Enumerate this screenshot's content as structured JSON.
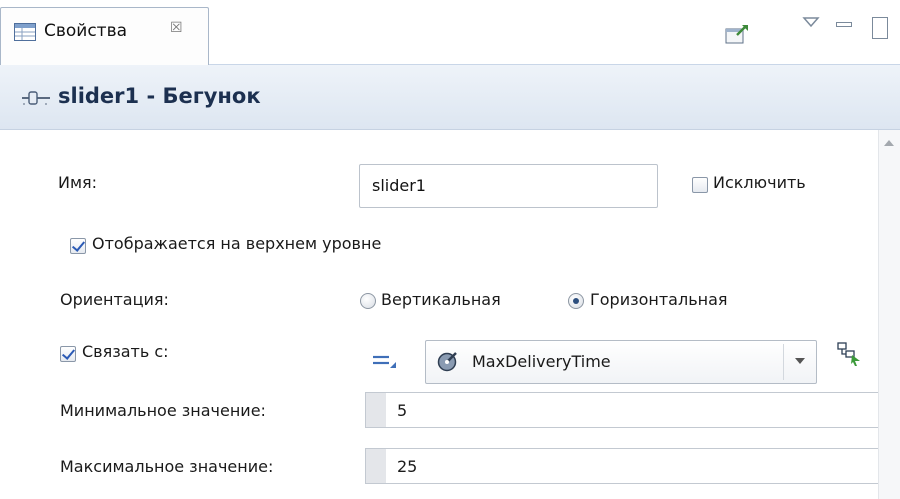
{
  "tab": {
    "label": "Свойства",
    "close_glyph": "☒",
    "icons": {
      "view": "properties-view-icon",
      "close": "close-icon",
      "pin": "pin-editor-icon",
      "menu": "view-menu-icon",
      "minimize": "minimize-icon",
      "maximize": "maximize-icon"
    }
  },
  "title": {
    "text": "slider1 - Бегунок",
    "icon": "slider-icon"
  },
  "form": {
    "name_label": "Имя:",
    "name_value": "slider1",
    "exclude_label": "Исключить",
    "exclude_checked": false,
    "top_level_label": "Отображается на верхнем уровне",
    "top_level_checked": true,
    "orientation_label": "Ориентация:",
    "orientation_options": [
      "Вертикальная",
      "Горизонтальная"
    ],
    "orientation_selected": "Горизонтальная",
    "link_label": "Связать с:",
    "link_checked": true,
    "link_value": "MaxDeliveryTime",
    "min_label": "Минимальное значение:",
    "min_value": "5",
    "max_label": "Максимальное значение:",
    "max_value": "25"
  },
  "colors": {
    "title_text": "#1c3050",
    "title_bg": "#dde6f1",
    "checkbox_mark": "#2c5bb6"
  }
}
